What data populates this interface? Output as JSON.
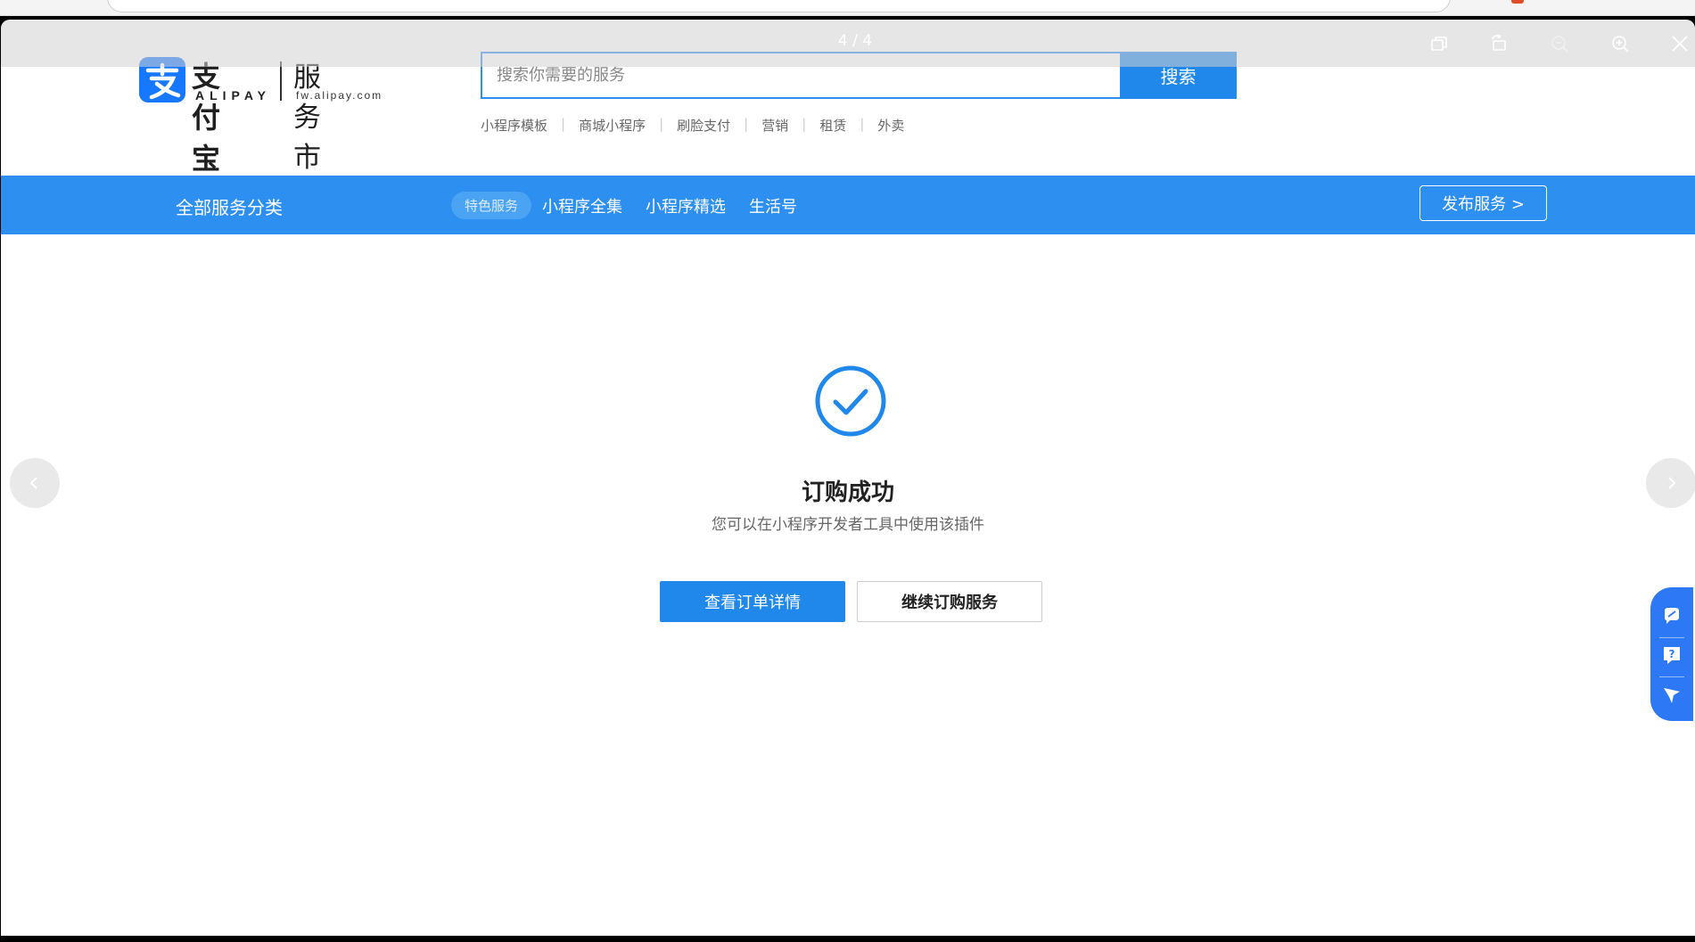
{
  "viewer": {
    "page_indicator": "4 / 4",
    "toolbar_icons": [
      "restore-icon",
      "rotate-icon",
      "zoom-out-icon",
      "zoom-in-icon",
      "close-icon"
    ]
  },
  "header": {
    "logo_cn": "支付宝",
    "logo_en": "ALIPAY",
    "logo_service": "服务市场",
    "logo_domain": "fw.alipay.com",
    "search_placeholder": "搜索你需要的服务",
    "search_button": "搜索",
    "hot_links": [
      "小程序模板",
      "商城小程序",
      "刷脸支付",
      "营销",
      "租赁",
      "外卖"
    ]
  },
  "nav": {
    "all_categories": "全部服务分类",
    "pill": "特色服务",
    "links": [
      "小程序全集",
      "小程序精选",
      "生活号"
    ],
    "publish": "发布服务 >"
  },
  "result": {
    "title": "订购成功",
    "description": "您可以在小程序开发者工具中使用该插件",
    "primary_button": "查看订单详情",
    "secondary_button": "继续订购服务"
  },
  "colors": {
    "brand_blue": "#1f88ea",
    "nav_blue": "#2d8ff0",
    "float_blue": "#2d78f4"
  }
}
